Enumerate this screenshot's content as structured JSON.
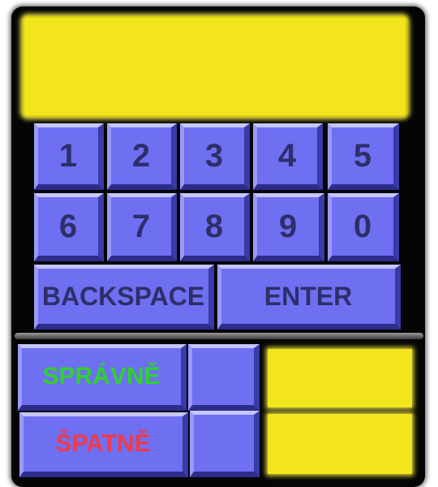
{
  "display": {
    "value": ""
  },
  "keypad": {
    "row1": [
      "1",
      "2",
      "3",
      "4",
      "5"
    ],
    "row2": [
      "6",
      "7",
      "8",
      "9",
      "0"
    ],
    "backspace_label": "BACKSPACE",
    "enter_label": "ENTER"
  },
  "score": {
    "correct_label": "SPRÁVNĚ",
    "wrong_label": "ŠPATNĚ",
    "correct_count": "",
    "wrong_count": ""
  },
  "colors": {
    "key": "#6f6ff2",
    "display": "#f2e51c",
    "correct": "#2fd12f",
    "wrong": "#f13a4a"
  }
}
